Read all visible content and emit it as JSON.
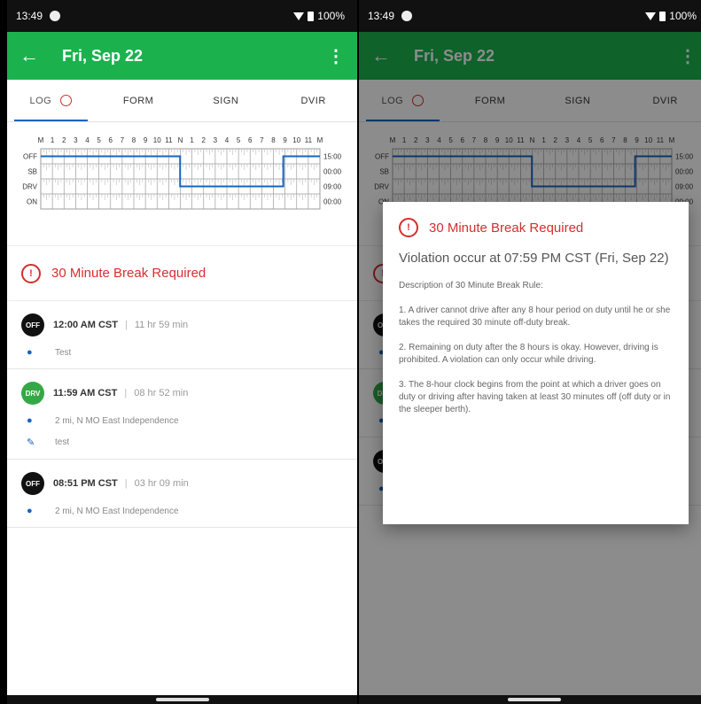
{
  "status_bar": {
    "time": "13:49",
    "battery": "100%"
  },
  "app_bar": {
    "title": "Fri, Sep 22",
    "back_icon": "arrow-left-icon",
    "menu_icon": "more-vert-icon"
  },
  "tabs": [
    {
      "label": "LOG",
      "active": true
    },
    {
      "label": "FORM"
    },
    {
      "label": "SIGN"
    },
    {
      "label": "DVIR"
    }
  ],
  "chart_data": {
    "type": "line",
    "x_tick_labels": [
      "M",
      "1",
      "2",
      "3",
      "4",
      "5",
      "6",
      "7",
      "8",
      "9",
      "10",
      "11",
      "N",
      "1",
      "2",
      "3",
      "4",
      "5",
      "6",
      "7",
      "8",
      "9",
      "10",
      "11",
      "M"
    ],
    "y_categories": [
      "OFF",
      "SB",
      "DRV",
      "ON"
    ],
    "totals": [
      "15:00",
      "00:00",
      "09:00",
      "00:00"
    ],
    "segments": [
      {
        "status": "OFF",
        "start": 0,
        "end": 11.98
      },
      {
        "status": "DRV",
        "start": 11.98,
        "end": 20.85
      },
      {
        "status": "OFF",
        "start": 20.85,
        "end": 24
      }
    ],
    "colors": {
      "line": "#1565c0",
      "grid": "#9e9e9e"
    }
  },
  "violation": {
    "title": "30 Minute Break Required",
    "icon_text": "!"
  },
  "events": [
    {
      "badge": "OFF",
      "time": "12:00 AM CST",
      "duration": "11 hr 59 min",
      "location": "Test",
      "note": ""
    },
    {
      "badge": "DRV",
      "time": "11:59 AM CST",
      "duration": "08 hr 52 min",
      "location": "2 mi, N MO East Independence",
      "note": "test"
    },
    {
      "badge": "OFF",
      "time": "08:51 PM CST",
      "duration": "03 hr 09 min",
      "location": "2 mi, N MO East Independence",
      "note": ""
    }
  ],
  "dialog": {
    "title": "30 Minute Break Required",
    "subtitle": "Violation occur at 07:59 PM CST (Fri, Sep 22)",
    "description_heading": "Description of 30 Minute Break Rule:",
    "rule_1": "1. A driver cannot drive after any 8 hour period on duty until he or she takes the required 30 minute off-duty break.",
    "rule_2": "2. Remaining on duty after the 8 hours is okay. However, driving is prohibited. A violation can only occur while driving.",
    "rule_3": "3. The 8-hour clock begins from the point at which a driver goes on duty or driving after having taken at least 30 minutes off (off duty or in the sleeper berth)."
  },
  "colors": {
    "accent": "#1bb24e",
    "warning": "#d32f2f",
    "line": "#1565c0"
  }
}
